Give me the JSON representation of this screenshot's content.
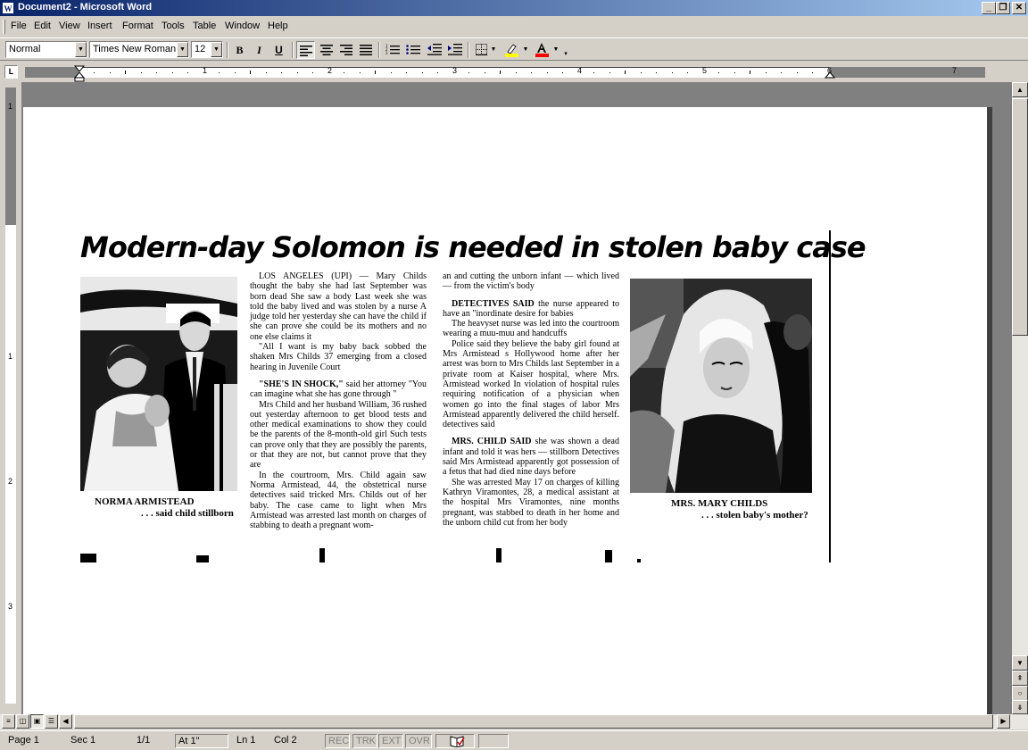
{
  "window": {
    "title": "Document2 - Microsoft Word",
    "app_icon": "word-icon",
    "controls": [
      "minimize-icon",
      "restore-icon",
      "close-icon"
    ]
  },
  "menu": [
    "File",
    "Edit",
    "View",
    "Insert",
    "Format",
    "Tools",
    "Table",
    "Window",
    "Help"
  ],
  "toolbar": {
    "style": "Normal",
    "font": "Times New Roman",
    "size": "12",
    "bold": "B",
    "italic": "I",
    "underline": "U",
    "icons": [
      "align-left-icon",
      "align-center-icon",
      "align-right-icon",
      "justify-icon",
      "numbering-icon",
      "bullets-icon",
      "decrease-indent-icon",
      "increase-indent-icon",
      "borders-icon",
      "highlight-icon",
      "font-color-icon"
    ],
    "highlight_color": "#ffff00",
    "font_color": "#ff0000"
  },
  "ruler": {
    "tab_selector": "L",
    "h_numbers": [
      "1",
      "2",
      "3",
      "4",
      "5",
      "6",
      "7"
    ],
    "v_numbers": [
      "1",
      "1",
      "2",
      "3"
    ]
  },
  "article": {
    "headline": "Modern-day Solomon is needed in stolen baby case",
    "caption_left": {
      "name": "NORMA ARMISTEAD",
      "sub": ". . . said child stillborn"
    },
    "caption_right": {
      "name": "MRS. MARY CHILDS",
      "sub": ". . . stolen baby's mother?"
    },
    "col1": {
      "p1": "LOS ANGELES (UPI) — Mary Childs thought the baby she had last September was born dead She saw a body Last week she was told the baby lived and was stolen by a nurse A judge told her yesterday she can have the child if she can prove she could be its mothers and no one else claims it",
      "p2": "\"All I want is my baby back sobbed the shaken Mrs Childs 37 emerging from a closed hearing in Juvenile Court",
      "p3_lead": "\"SHE'S IN SHOCK,\"",
      "p3": " said her attorney \"You can imagine what she has gone through \"",
      "p4": "Mrs Child and her husband William, 36 rushed out yesterday afternoon to get blood tests and other medical examinations to show they could be the parents of the 8-month-old girl Such tests can prove only that they are possibly the parents, or that they are not, but cannot prove that they are",
      "p5": "In the courtroom, Mrs. Child again saw Norma Armistead, 44, the obstetrical nurse detectives said tricked Mrs. Childs out of her baby. The case came to light when Mrs Armistead was arrested last month on charges of stabbing to death a pregnant wom-"
    },
    "col2": {
      "p1": "an and cutting the unborn infant — which lived — from the victim's body",
      "p2_lead": "DETECTIVES SAID",
      "p2": " the nurse appeared to have an \"inordinate desire for babies",
      "p3": "The heavyset nurse was led into the courtroom wearing a muu-muu and handcuffs",
      "p4": "Police said they believe the baby girl found at Mrs Armistead s Hollywood home after her arrest was born to Mrs Childs last September in a private room at Kaiser hospital, where Mrs. Armistead worked In violation of hospital rules requiring notification of a physician when women go into the final stages of labor Mrs Armistead apparently delivered the child herself. detectives said",
      "p5_lead": "MRS. CHILD SAID",
      "p5": " she was shown a dead infant and told it was hers — stillborn Detectives said Mrs Armistead apparently got possession of a fetus that had died nine days before",
      "p6": "She was arrested May 17 on charges of killing Kathryn Viramontes, 28, a medical assistant at the hospital Mrs Viramontes, nine months pregnant, was stabbed to death in her home and the unborn child cut from her body"
    }
  },
  "status": {
    "page": "Page 1",
    "sec": "Sec 1",
    "pages": "1/1",
    "at": "At 1\"",
    "ln": "Ln 1",
    "col": "Col 2",
    "rec": "REC",
    "trk": "TRK",
    "ext": "EXT",
    "ovr": "OVR",
    "book_icon": "spelling-book-icon"
  }
}
